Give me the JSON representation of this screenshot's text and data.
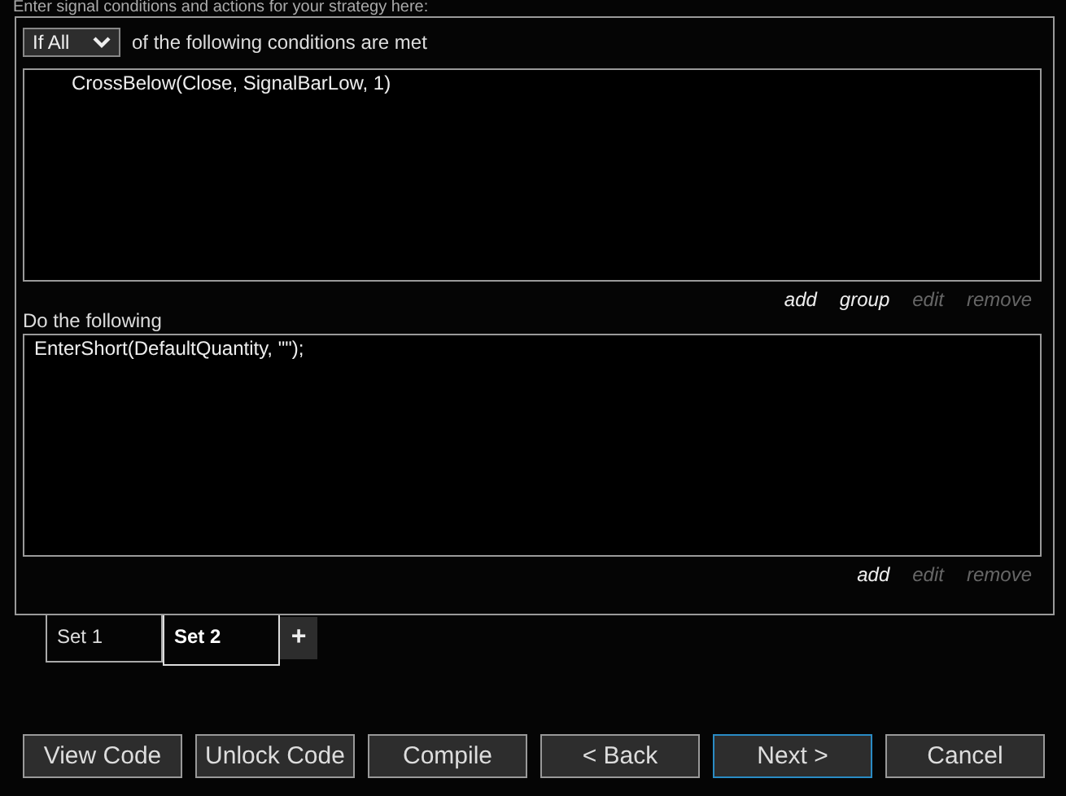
{
  "header": "Enter signal conditions and actions for your strategy here:",
  "condition_mode": {
    "value": "If All"
  },
  "conditions_label": "of the following conditions are met",
  "conditions": [
    "CrossBelow(Close, SignalBarLow, 1)"
  ],
  "condition_links": [
    {
      "label": "add",
      "disabled": false
    },
    {
      "label": "group",
      "disabled": false
    },
    {
      "label": "edit",
      "disabled": true
    },
    {
      "label": "remove",
      "disabled": true
    }
  ],
  "actions_label": "Do the following",
  "actions": [
    "EnterShort(DefaultQuantity, \"\");"
  ],
  "action_links": [
    {
      "label": "add",
      "disabled": false
    },
    {
      "label": "edit",
      "disabled": true
    },
    {
      "label": "remove",
      "disabled": true
    }
  ],
  "tabs": [
    {
      "label": "Set 1",
      "selected": false
    },
    {
      "label": "Set 2",
      "selected": true
    }
  ],
  "add_tab": "+",
  "buttons": [
    {
      "label": "View Code",
      "focused": false
    },
    {
      "label": "Unlock Code",
      "focused": false
    },
    {
      "label": "Compile",
      "focused": false
    },
    {
      "label": "< Back",
      "focused": false
    },
    {
      "label": "Next >",
      "focused": true
    },
    {
      "label": "Cancel",
      "focused": false
    }
  ]
}
